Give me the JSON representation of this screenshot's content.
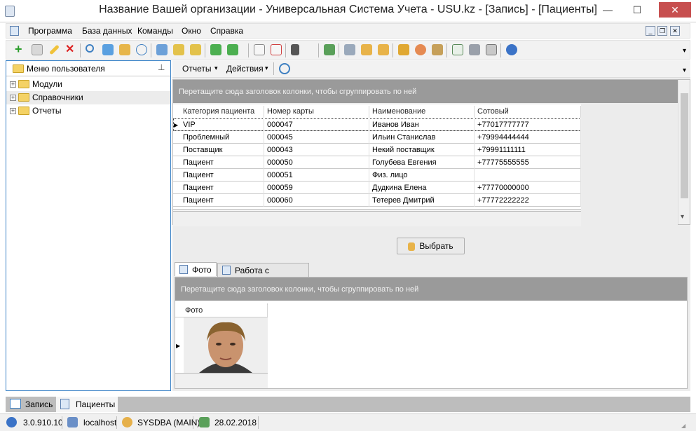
{
  "window": {
    "title": "Название Вашей организации - Универсальная Система Учета - USU.kz - [Запись] - [Пациенты]",
    "minimize_glyph": "—",
    "maximize_glyph": "☐",
    "close_glyph": "✕"
  },
  "menu": {
    "items": [
      "Программа",
      "База данных",
      "Команды",
      "Окно",
      "Справка"
    ],
    "mdi_minimize": "_",
    "mdi_restore": "❐",
    "mdi_close": "✕"
  },
  "toolbar": {
    "overflow_glyph": "▾"
  },
  "sidebar": {
    "title": "Меню пользователя",
    "pin_glyph": "⊥",
    "items": [
      {
        "label": "Модули"
      },
      {
        "label": "Справочники"
      },
      {
        "label": "Отчеты"
      }
    ]
  },
  "sub_toolbar": {
    "reports_label": "Отчеты",
    "actions_label": "Действия",
    "dropdown_glyph": "▾"
  },
  "patients_grid": {
    "group_hint": "Перетащите сюда заголовок колонки, чтобы сгруппировать по ней",
    "columns": [
      "Категория пациента",
      "Номер карты",
      "Наименование",
      "Сотовый"
    ],
    "rows": [
      [
        "VIP",
        "000047",
        "Иванов Иван",
        "+77017777777"
      ],
      [
        "Проблемный",
        "000045",
        "Ильин Станислав",
        "+79994444444"
      ],
      [
        "Поставщик",
        "000043",
        "Некий поставщик",
        "+79991111111"
      ],
      [
        "Пациент",
        "000050",
        "Голубева Евгения",
        "+77775555555"
      ],
      [
        "Пациент",
        "000051",
        "Физ. лицо",
        ""
      ],
      [
        "Пациент",
        "000059",
        "Дудкина Елена",
        "+77770000000"
      ],
      [
        "Пациент",
        "000060",
        "Тетерев Дмитрий",
        "+77772222222"
      ]
    ],
    "current_row_marker": "▶"
  },
  "select_button": {
    "label": "Выбрать"
  },
  "detail_tabs": {
    "items": [
      "Фото",
      "Работа с пациентом"
    ]
  },
  "photo_grid": {
    "group_hint": "Перетащите сюда заголовок колонки, чтобы сгруппировать по ней",
    "column": "Фото",
    "current_row_marker": "▶"
  },
  "doc_tabs": {
    "items": [
      "Запись",
      "Пациенты"
    ]
  },
  "status": {
    "version": "3.0.910.10",
    "host": "localhost",
    "user": "SYSDBA (MAIN)",
    "date": "28.02.2018"
  }
}
